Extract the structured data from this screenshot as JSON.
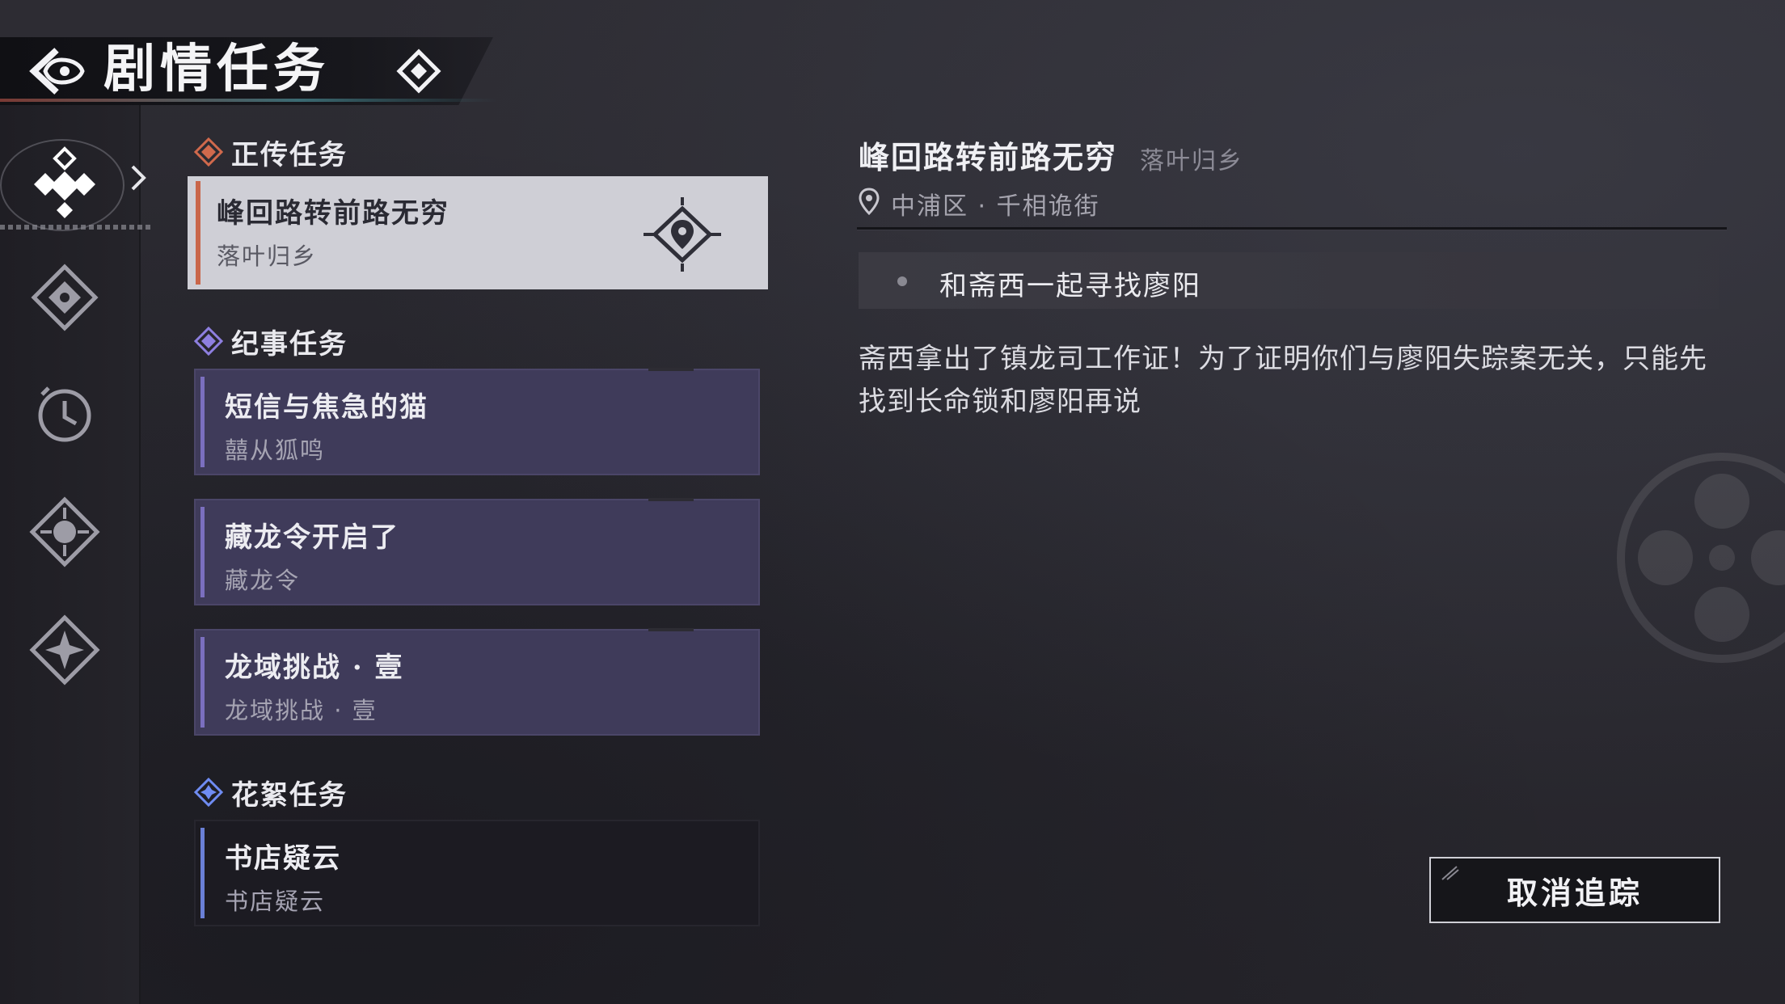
{
  "header": {
    "title": "剧情任务"
  },
  "rail": {
    "items": [
      {
        "icon": "story-quests-icon",
        "active": true
      },
      {
        "icon": "chronicle-quests-icon"
      },
      {
        "icon": "clock-icon"
      },
      {
        "icon": "compass-diamond-icon"
      },
      {
        "icon": "star-diamond-icon"
      }
    ]
  },
  "sections": {
    "story": {
      "label": "正传任务",
      "color": "#d0694c"
    },
    "chronicle": {
      "label": "纪事任务",
      "color": "#8e7fe0"
    },
    "side": {
      "label": "花絮任务",
      "color": "#6f8cf2"
    }
  },
  "quests": {
    "story": [
      {
        "title": "峰回路转前路无穷",
        "subtitle": "落叶归乡",
        "tracked": true
      }
    ],
    "chronicle": [
      {
        "title": "短信与焦急的猫",
        "subtitle": "囍从狐鸣"
      },
      {
        "title": "藏龙令开启了",
        "subtitle": "藏龙令"
      },
      {
        "title": "龙域挑战 · 壹",
        "subtitle": "龙域挑战 · 壹"
      }
    ],
    "side": [
      {
        "title": "书店疑云",
        "subtitle": "书店疑云"
      }
    ]
  },
  "detail": {
    "title": "峰回路转前路无穷",
    "subtitle": "落叶归乡",
    "location": "中浦区 · 千相诡街",
    "objective": "和斋西一起寻找廖阳",
    "description": "斋西拿出了镇龙司工作证！为了证明你们与廖阳失踪案无关，只能先找到长命锁和廖阳再说",
    "cancel_label": "取消追踪"
  }
}
